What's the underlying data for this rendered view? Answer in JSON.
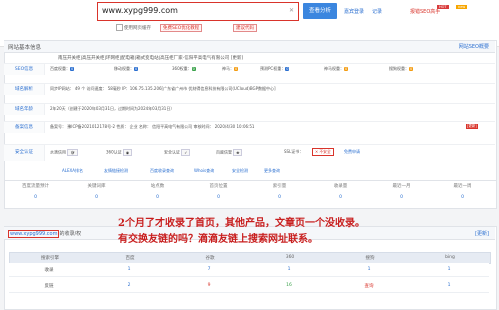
{
  "header": {
    "search_value": "www.xypg999.com",
    "search_button": "查看分析",
    "links": [
      "嘉宾登录",
      "记录"
    ],
    "promo_text": "报错SEO高手",
    "hot_badge": "HOT",
    "new_badge": "new",
    "checkbox_label": "使用网页缓存",
    "promo_red": "免费SEO优化教程",
    "promo_box": "建议代码"
  },
  "panel": {
    "title": "网站基本信息",
    "right_link": "网站SEO概要",
    "description": "南压开关柜|高压开关柜|环网柜|配电箱|箱式变电站|高压柜厂家-信阳平高电气有限公司 [更新]"
  },
  "rows": {
    "seo": {
      "label": "SEO信息",
      "items": [
        {
          "name": "百度权重：",
          "val": "0"
        },
        {
          "name": "移动权重：",
          "val": "0"
        },
        {
          "name": "360权重：",
          "val": "0"
        },
        {
          "name": "神马：",
          "val": "0"
        },
        {
          "name": "预测PC权重：",
          "val": "0"
        },
        {
          "name": "神马权重：",
          "val": "0"
        },
        {
          "name": "搜狗权重：",
          "val": "0"
        }
      ]
    },
    "dns": {
      "label": "域名解析",
      "text": "同步IP网站： 49 个   访问速度： 58毫秒    IP：106.75.135.206[广东省广州市 优刻得信息科技有限公司(UCloud)BGP数据中心]"
    },
    "age": {
      "label": "域名年龄",
      "text": "2年20天（创建于2020年03月31日，过期时间为2024年03月31日）"
    },
    "icp": {
      "label": "备案信息",
      "text": "备案号：  豫ICP备2021012178号-2    性质：  企业    名称：  信阳平高电气有限公司    审核时间：  2020/4/30 10:06:51",
      "update": "[更新]"
    },
    "security": {
      "label": "安全认证",
      "items": [
        "水滴信用",
        "360认证",
        "安全认证",
        "百度信誉",
        "SSL证书：",
        "不安全",
        "免费申请"
      ]
    },
    "tools": [
      "ALEXA排名",
      "友情链接检测",
      "百度收录查询",
      "Whois查询",
      "安全检测",
      "更多查询"
    ]
  },
  "stats": {
    "headers": [
      "百度流量预计",
      "关键词库",
      "站点数",
      "首页位置",
      "索引量",
      "收录量",
      "最近一月",
      "最近一周"
    ],
    "values": [
      "0",
      "0",
      "0",
      "0",
      "0",
      "0",
      "0",
      "0"
    ]
  },
  "annotations": {
    "line1": "2个月了才收录了首页，其他产品，文章页一个没收录。",
    "line2": "有交换友链的吗？滴滴友链上搜索网址联系。"
  },
  "bottom": {
    "title_url": "www.xypg999.com",
    "title_suffix": "的收录/权",
    "right_link": "[更新]",
    "headers": [
      "搜索引擎",
      "百度",
      "谷歌",
      "360",
      "搜狗",
      "bing"
    ],
    "rows": [
      {
        "label": "收录",
        "vals": [
          "1",
          "7",
          "1",
          "1",
          "1"
        ]
      },
      {
        "label": "反链",
        "vals": [
          "2",
          "9",
          "16",
          "查询",
          "1"
        ]
      }
    ]
  }
}
